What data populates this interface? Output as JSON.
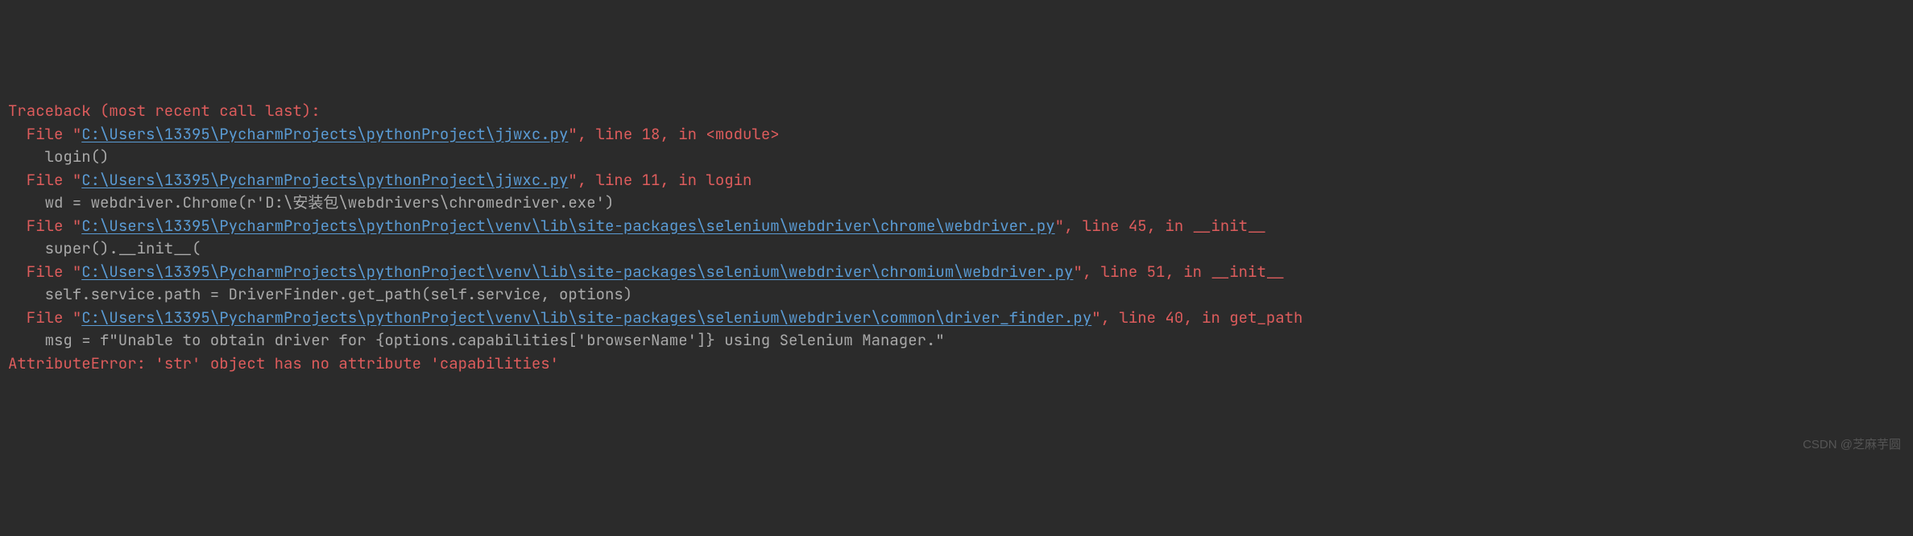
{
  "traceback": {
    "header": "Traceback (most recent call last):",
    "frames": [
      {
        "prefix": "  File ",
        "quote1": "\"",
        "path": "C:\\Users\\13395\\PycharmProjects\\pythonProject\\jjwxc.py",
        "quote2": "\"",
        "suffix": ", line 18, in <module>",
        "code": "    login()"
      },
      {
        "prefix": "  File ",
        "quote1": "\"",
        "path": "C:\\Users\\13395\\PycharmProjects\\pythonProject\\jjwxc.py",
        "quote2": "\"",
        "suffix": ", line 11, in login",
        "code": "    wd = webdriver.Chrome(r'D:\\安装包\\webdrivers\\chromedriver.exe')"
      },
      {
        "prefix": "  File ",
        "quote1": "\"",
        "path": "C:\\Users\\13395\\PycharmProjects\\pythonProject\\venv\\lib\\site-packages\\selenium\\webdriver\\chrome\\webdriver.py",
        "quote2": "\"",
        "suffix": ", line 45, in __init__",
        "code": "    super().__init__("
      },
      {
        "prefix": "  File ",
        "quote1": "\"",
        "path": "C:\\Users\\13395\\PycharmProjects\\pythonProject\\venv\\lib\\site-packages\\selenium\\webdriver\\chromium\\webdriver.py",
        "quote2": "\"",
        "suffix": ", line 51, in __init__",
        "code": "    self.service.path = DriverFinder.get_path(self.service, options)"
      },
      {
        "prefix": "  File ",
        "quote1": "\"",
        "path": "C:\\Users\\13395\\PycharmProjects\\pythonProject\\venv\\lib\\site-packages\\selenium\\webdriver\\common\\driver_finder.py",
        "quote2": "\"",
        "suffix": ", line 40, in get_path",
        "code": "    msg = f\"Unable to obtain driver for {options.capabilities['browserName']} using Selenium Manager.\""
      }
    ],
    "error_type": "AttributeError",
    "error_separator": ": ",
    "error_message": "'str' object has no attribute 'capabilities'"
  },
  "watermark": "CSDN @芝麻芋圆"
}
